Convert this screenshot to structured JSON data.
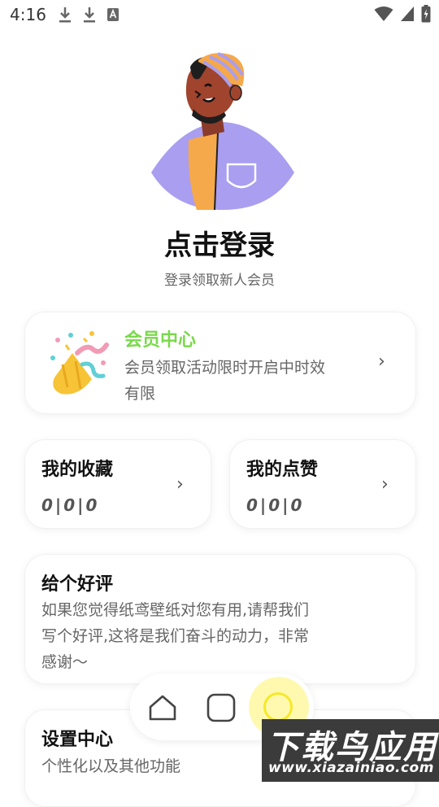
{
  "status_bar": {
    "time": "4:16",
    "left_icons": [
      "download-icon",
      "download-icon",
      "font-icon"
    ],
    "right_icons": [
      "wifi-icon",
      "signal-icon",
      "battery-icon"
    ]
  },
  "profile": {
    "login_label": "点击登录",
    "login_hint": "登录领取新人会员"
  },
  "vip_card": {
    "title": "会员中心",
    "description": "会员领取活动限时开启中时效有限"
  },
  "favorites_card": {
    "title": "我的收藏",
    "count": "0|0|0"
  },
  "likes_card": {
    "title": "我的点赞",
    "count": "0|0|0"
  },
  "rate_card": {
    "title": "给个好评",
    "description": "如果您觉得纸鸢壁纸对您有用,请帮我们写个好评,这将是我们奋斗的动力，非常感谢～"
  },
  "settings_card": {
    "title": "设置中心",
    "description": "个性化以及其他功能"
  },
  "watermark": {
    "main": "下载鸟应用",
    "url": "www.xiazainiao.com"
  },
  "colors": {
    "vip_title": "#79d94a",
    "nav_accent": "#f7e829",
    "avatar_shirt": "#a99ef0",
    "avatar_hat": "#f6a94a"
  }
}
